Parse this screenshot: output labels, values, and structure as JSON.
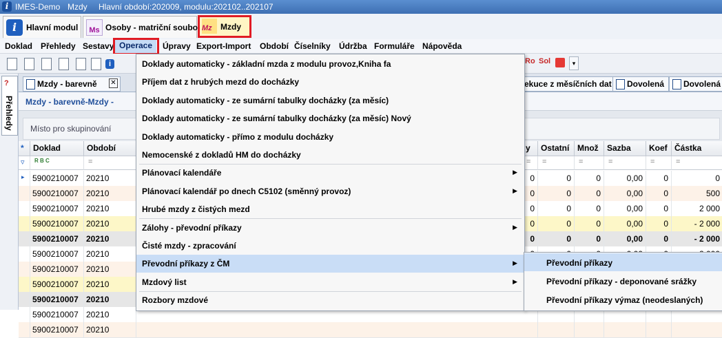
{
  "titlebar": {
    "app": "IMES-Demo",
    "module": "Mzdy",
    "period": "Hlavní období:202009, modulu:202102..202107"
  },
  "module_tabs": [
    {
      "label": "Hlavní modul"
    },
    {
      "label": "Osoby - matriční soubor",
      "icon_text": "Ms"
    },
    {
      "label": "Mzdy",
      "icon_text": "Mz"
    }
  ],
  "menubar": [
    "Doklad",
    "Přehledy",
    "Sestavy",
    "Operace",
    "Úpravy",
    "Export-Import",
    "Období",
    "Číselníky",
    "Údržba",
    "Formuláře",
    "Nápověda"
  ],
  "toolbar_right": [
    "Ro",
    "Sol"
  ],
  "left_panel": {
    "tab_label": "Přehledy"
  },
  "doc_tabs": {
    "active": "Mzdy - barevně",
    "right": [
      "ekuce z měsíčních dat",
      "Dovolená",
      "Dovolená"
    ]
  },
  "breadcrumb": "Mzdy - barevně-Mzdy -",
  "group_panel": "Místo pro skupinování",
  "grid": {
    "columns_left": [
      "Doklad",
      "Období"
    ],
    "columns_right": [
      "y",
      "Ostatní",
      "Množ",
      "Sazba",
      "Koef",
      "Částka"
    ],
    "filter_symbol": "=",
    "filter_text": "R B C",
    "rows": [
      {
        "doklad": "5900210007",
        "obdobi": "20210",
        "y": "0",
        "ostatni": "0",
        "mnoz": "0",
        "sazba": "0,00",
        "koef": "0",
        "castka": "0",
        "bold": false,
        "bg": "#ffffff"
      },
      {
        "doklad": "5900210007",
        "obdobi": "20210",
        "y": "0",
        "ostatni": "0",
        "mnoz": "0",
        "sazba": "0,00",
        "koef": "0",
        "castka": "500",
        "bold": false,
        "bg": "#fdf2e8"
      },
      {
        "doklad": "5900210007",
        "obdobi": "20210",
        "y": "0",
        "ostatni": "0",
        "mnoz": "0",
        "sazba": "0,00",
        "koef": "0",
        "castka": "2 000",
        "bold": false,
        "bg": "#ffffff"
      },
      {
        "doklad": "5900210007",
        "obdobi": "20210",
        "y": "0",
        "ostatni": "0",
        "mnoz": "0",
        "sazba": "0,00",
        "koef": "0",
        "castka": "- 2 000",
        "bold": false,
        "bg": "#fdf7c8"
      },
      {
        "doklad": "5900210007",
        "obdobi": "20210",
        "y": "0",
        "ostatni": "0",
        "mnoz": "0",
        "sazba": "0,00",
        "koef": "0",
        "castka": "- 2 000",
        "bold": true,
        "bg": "#e6e6e6"
      },
      {
        "doklad": "5900210007",
        "obdobi": "20210",
        "y": "0",
        "ostatni": "0",
        "mnoz": "0",
        "sazba": "0,00",
        "koef": "0",
        "castka": "- 2 000",
        "bold": false,
        "bg": "#ffffff"
      },
      {
        "doklad": "5900210007",
        "obdobi": "20210",
        "y": "",
        "ostatni": "",
        "mnoz": "",
        "sazba": "",
        "koef": "",
        "castka": "",
        "bold": false,
        "bg": "#fdf2e8"
      },
      {
        "doklad": "5900210007",
        "obdobi": "20210",
        "y": "",
        "ostatni": "",
        "mnoz": "",
        "sazba": "",
        "koef": "",
        "castka": "",
        "bold": false,
        "bg": "#fdf7c8"
      },
      {
        "doklad": "5900210007",
        "obdobi": "20210",
        "y": "",
        "ostatni": "",
        "mnoz": "",
        "sazba": "",
        "koef": "",
        "castka": "",
        "bold": true,
        "bg": "#e6e6e6"
      },
      {
        "doklad": "5900210007",
        "obdobi": "20210",
        "y": "",
        "ostatni": "",
        "mnoz": "",
        "sazba": "",
        "koef": "",
        "castka": "",
        "bold": false,
        "bg": "#ffffff"
      },
      {
        "doklad": "5900210007",
        "obdobi": "20210",
        "y": "",
        "ostatni": "",
        "mnoz": "",
        "sazba": "",
        "koef": "",
        "castka": "",
        "bold": false,
        "bg": "#fdf2e8"
      }
    ]
  },
  "dropdown": {
    "items": [
      {
        "label": "Doklady automaticky - základní mzda z modulu provoz,Kniha fa",
        "arrow": false
      },
      {
        "label": "Příjem dat z hrubých mezd do docházky",
        "arrow": false
      },
      {
        "label": "Doklady automaticky - ze sumární tabulky docházky (za měsíc)",
        "arrow": false
      },
      {
        "label": "Doklady automaticky - ze sumární tabulky docházky (za měsíc) Nový",
        "arrow": false
      },
      {
        "label": "Doklady automaticky - přímo z modulu docházky",
        "arrow": false
      },
      {
        "label": "Nemocenské z dokladů HM do docházky",
        "arrow": false
      },
      {
        "label": "Plánovací kalendáře",
        "arrow": true
      },
      {
        "label": "Plánovací kalendář po dnech C5102 (směnný provoz)",
        "arrow": true
      },
      {
        "label": "Hrubé mzdy z čistých mezd",
        "arrow": false
      },
      {
        "label": "Zálohy - převodní příkazy",
        "arrow": true
      },
      {
        "label": "Čisté mzdy - zpracování",
        "arrow": false
      },
      {
        "label": "Převodní příkazy z ČM",
        "arrow": true
      },
      {
        "label": "Mzdový list",
        "arrow": true
      },
      {
        "label": "Rozbory mzdové",
        "arrow": false
      }
    ]
  },
  "submenu": {
    "items": [
      {
        "label": "Převodní příkazy"
      },
      {
        "label": "Převodní příkazy - deponované srážky"
      },
      {
        "label": "Převodní příkazy výmaz (neodeslaných)"
      }
    ]
  },
  "colors": {
    "highlight": "#c9ddf6",
    "red_frame": "#e01b24",
    "title_bar": "#4a7ec2"
  }
}
